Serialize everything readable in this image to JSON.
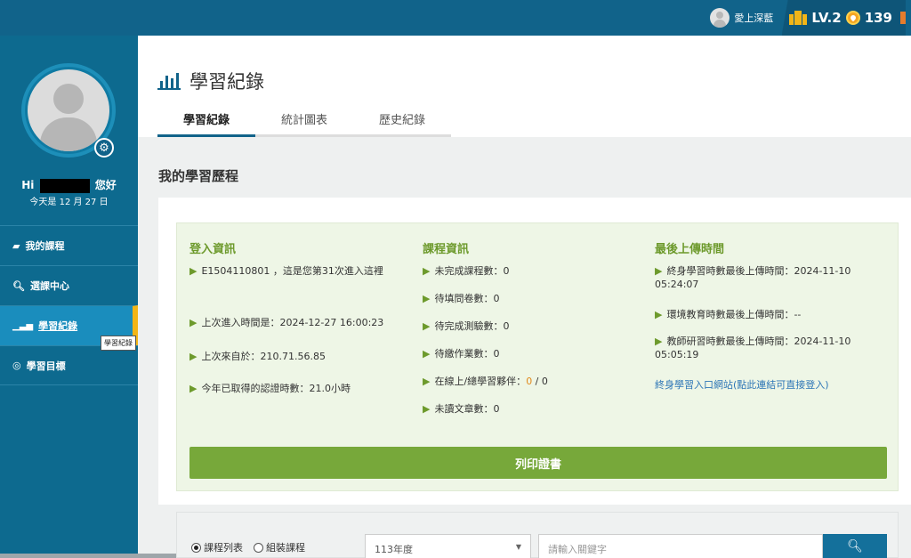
{
  "topbar": {
    "username": "愛上深藍",
    "level": "LV.2",
    "coins": "139"
  },
  "sidebar": {
    "greeting_prefix": "Hi",
    "greeting_suffix": "您好",
    "today": "今天是 12 月 27 日",
    "items": [
      {
        "label": "我的課程",
        "icon": "book-icon"
      },
      {
        "label": "選課中心",
        "icon": "search-icon"
      },
      {
        "label": "學習紀錄",
        "icon": "bar-chart-icon"
      },
      {
        "label": "學習目標",
        "icon": "target-icon"
      }
    ],
    "tooltip": "學習紀錄"
  },
  "header": {
    "title": "學習紀錄",
    "tabs": [
      "學習紀錄",
      "統計圖表",
      "歷史紀錄"
    ]
  },
  "main": {
    "section_title": "我的學習歷程",
    "login_info": {
      "heading": "登入資訊",
      "line1": "E1504110801 ，這是您第31次進入這裡",
      "line2": "上次進入時間是：2024-12-27 16:00:23",
      "line3": "上次來自於：210.71.56.85",
      "line4": "今年已取得的認證時數：21.0小時"
    },
    "course_info": {
      "heading": "課程資訊",
      "line1": "未完成課程數：0",
      "line2": "待填問卷數：0",
      "line3": "待完成測驗數：0",
      "line4": "待繳作業數：0",
      "line5_prefix": "在線上/總學習夥伴：",
      "line5_online": "0",
      "line5_sep": " / ",
      "line5_total": "0",
      "line6": "未讀文章數：0"
    },
    "upload_info": {
      "heading": "最後上傳時間",
      "line1a": "終身學習時數最後上傳時間：2024-11-10",
      "line1b": "05:24:07",
      "line2": "環境教育時數最後上傳時間：--",
      "line3a": "教師研習時數最後上傳時間：2024-11-10",
      "line3b": "05:05:19",
      "link": "終身學習入口網站(點此連結可直接登入)"
    },
    "print_button": "列印證書"
  },
  "filter": {
    "radio1": "課程列表",
    "radio2": "組裝課程",
    "year": "113年度",
    "keyword_placeholder": "請輸入關鍵字"
  },
  "colors": {
    "topbar": "#11638a",
    "sidebar": "#0d6a8f",
    "accent_green": "#77a83a",
    "active_border": "#f2b517"
  }
}
